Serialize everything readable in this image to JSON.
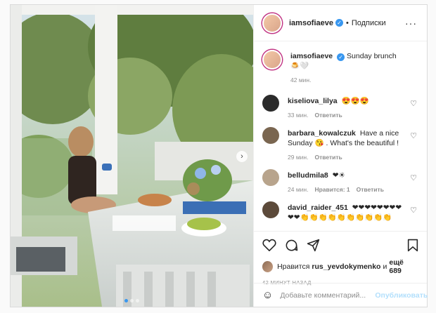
{
  "post": {
    "author": "iamsofiaeve",
    "follow_label": "Подписки",
    "more_icon": "more-horizontal-icon",
    "caption": {
      "user": "iamsofiaeve",
      "text": "Sunday brunch 🍮🤍",
      "time": "42 мин."
    },
    "comments": [
      {
        "user": "kiseliova_lilya",
        "text": "😍😍😍",
        "time": "33 мин.",
        "likes": "",
        "reply_label": "Ответить",
        "avatar_color": "#2b2b2b"
      },
      {
        "user": "barbara_kowalczuk",
        "text": "Have a nice Sunday 😘 . What's the beautiful !",
        "time": "29 мин.",
        "likes": "",
        "reply_label": "Ответить",
        "avatar_color": "#7a6650"
      },
      {
        "user": "belludmila8",
        "text": "❤☀",
        "time": "24 мин.",
        "likes": "Нравится: 1",
        "reply_label": "Ответить",
        "avatar_color": "#b8a48c"
      },
      {
        "user": "david_raider_451",
        "text": "❤❤❤❤❤❤❤❤❤❤👏👏👏👏👏👏👏👏👏👏",
        "time": "",
        "likes": "",
        "reply_label": "",
        "avatar_color": "#5c4a3a"
      }
    ],
    "likes": {
      "prefix": "Нравится",
      "user": "rus_yevdokymenko",
      "connector": "и",
      "others": "ещё 689"
    },
    "time_ago": "42 минут назад",
    "add_comment": {
      "placeholder": "Добавьте комментарий...",
      "publish_label": "Опубликовать"
    },
    "carousel": {
      "slide_count": 3,
      "active_index": 0
    }
  },
  "colors": {
    "accent": "#3897f0",
    "publish_disabled": "#b2dffc",
    "muted": "#8e8e8e"
  }
}
